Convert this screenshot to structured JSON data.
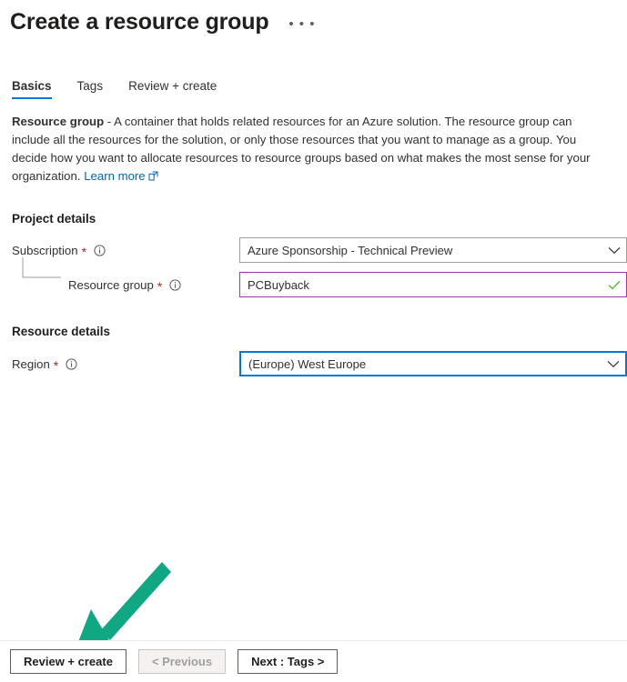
{
  "header": {
    "title": "Create a resource group",
    "menu_glyph": "• • •"
  },
  "tabs": [
    {
      "label": "Basics",
      "active": true
    },
    {
      "label": "Tags",
      "active": false
    },
    {
      "label": "Review + create",
      "active": false
    }
  ],
  "description": {
    "lead": "Resource group",
    "body": " - A container that holds related resources for an Azure solution. The resource group can include all the resources for the solution, or only those resources that you want to manage as a group. You decide how you want to allocate resources to resource groups based on what makes the most sense for your organization. ",
    "link_label": "Learn more"
  },
  "sections": {
    "project_details": {
      "title": "Project details",
      "fields": {
        "subscription": {
          "label": "Subscription",
          "required_marker": "*",
          "value": "Azure Sponsorship - Technical Preview"
        },
        "resource_group": {
          "label": "Resource group",
          "required_marker": "*",
          "value": "PCBuyback"
        }
      }
    },
    "resource_details": {
      "title": "Resource details",
      "fields": {
        "region": {
          "label": "Region",
          "required_marker": "*",
          "value": "(Europe) West Europe"
        }
      }
    }
  },
  "footer": {
    "review_create_label": "Review + create",
    "previous_label": "< Previous",
    "next_label": "Next : Tags >"
  },
  "colors": {
    "accent_blue": "#0078d4",
    "link_blue": "#0067b8",
    "required_red": "#a4262c",
    "valid_purple": "#a335b5",
    "valid_check_green": "#5ab639",
    "annotation_teal": "#0fa882"
  }
}
